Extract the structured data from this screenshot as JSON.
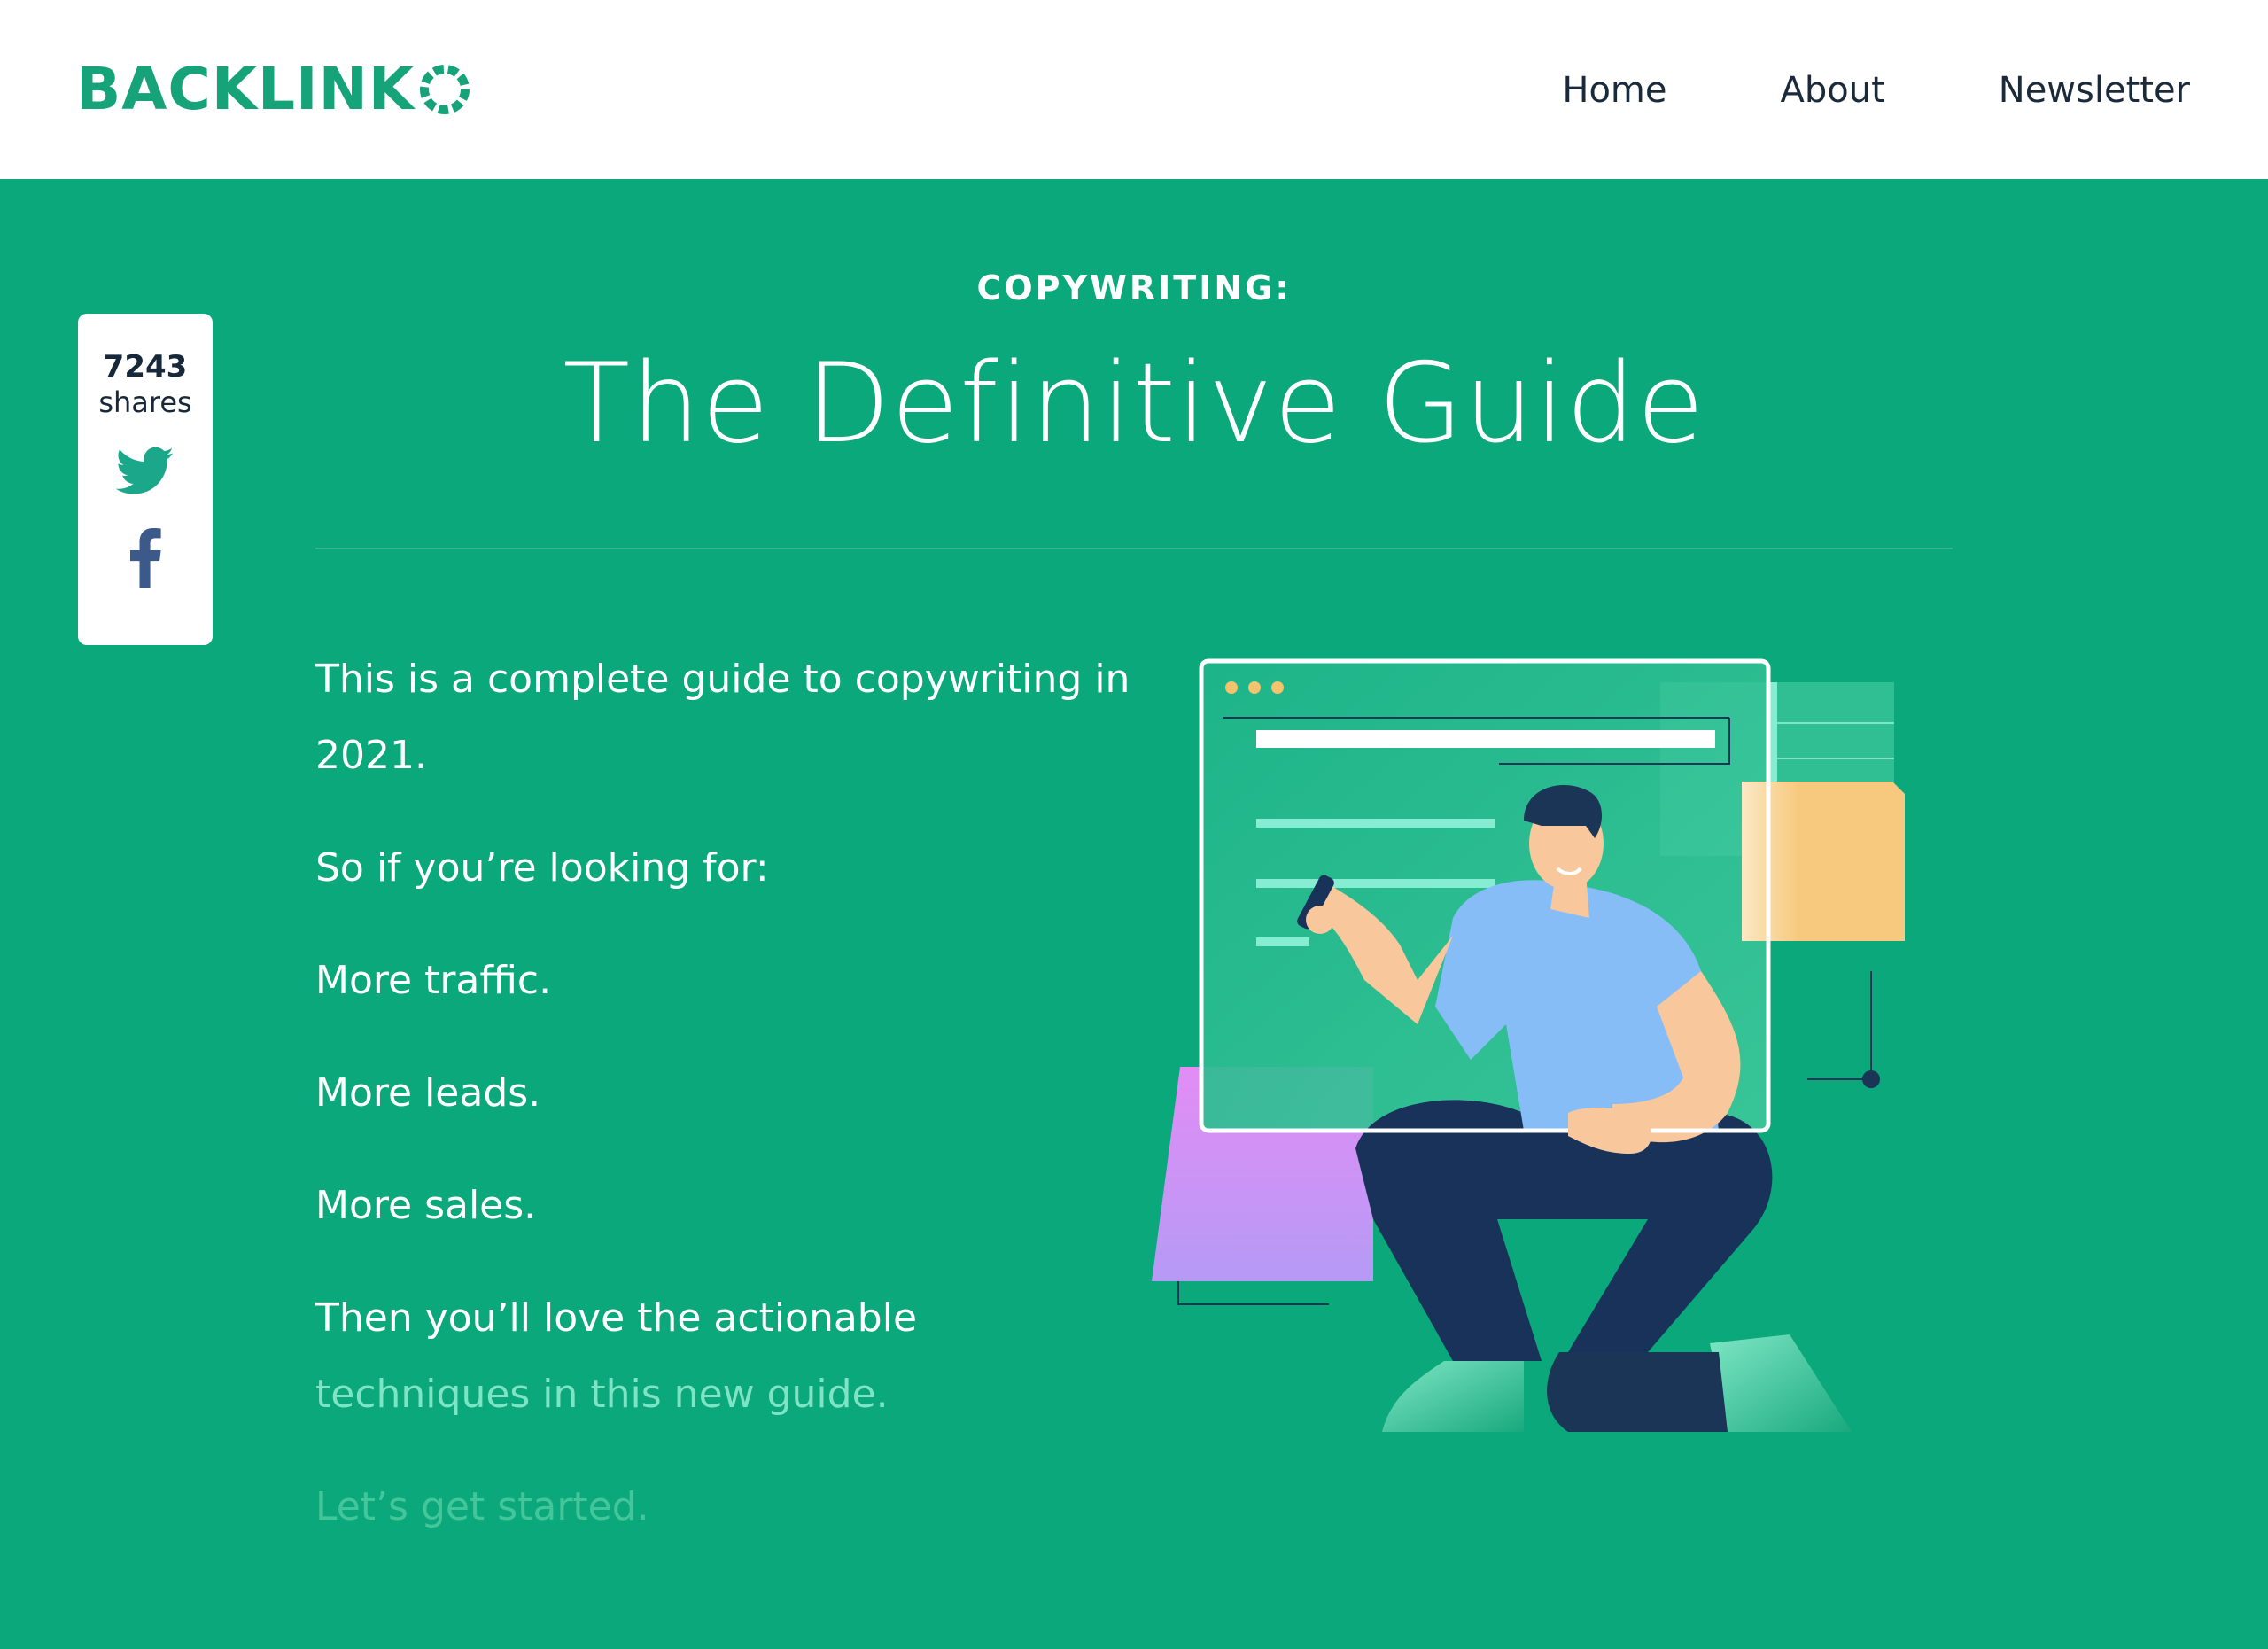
{
  "header": {
    "logo_text": "BACKLINK",
    "nav": [
      {
        "label": "Home"
      },
      {
        "label": "About"
      },
      {
        "label": "Newsletter"
      }
    ]
  },
  "share": {
    "count": "7243",
    "label": "shares",
    "icons": [
      "twitter-icon",
      "facebook-icon"
    ]
  },
  "hero": {
    "kicker": "COPYWRITING:",
    "title": "The Definitive Guide"
  },
  "intro": {
    "paragraphs": [
      "This is a complete guide to copywriting in 2021.",
      "So if you’re looking for:",
      "More traffic.",
      "More leads.",
      "More sales."
    ],
    "closing_line_1": "Then you’ll love the actionable",
    "closing_line_2": "techniques in this new guide.",
    "last_line": "Let’s get started."
  },
  "colors": {
    "brand_green": "#0aa87a",
    "logo_green": "#16a37a",
    "nav_text": "#1b2a3a",
    "white": "#ffffff"
  }
}
